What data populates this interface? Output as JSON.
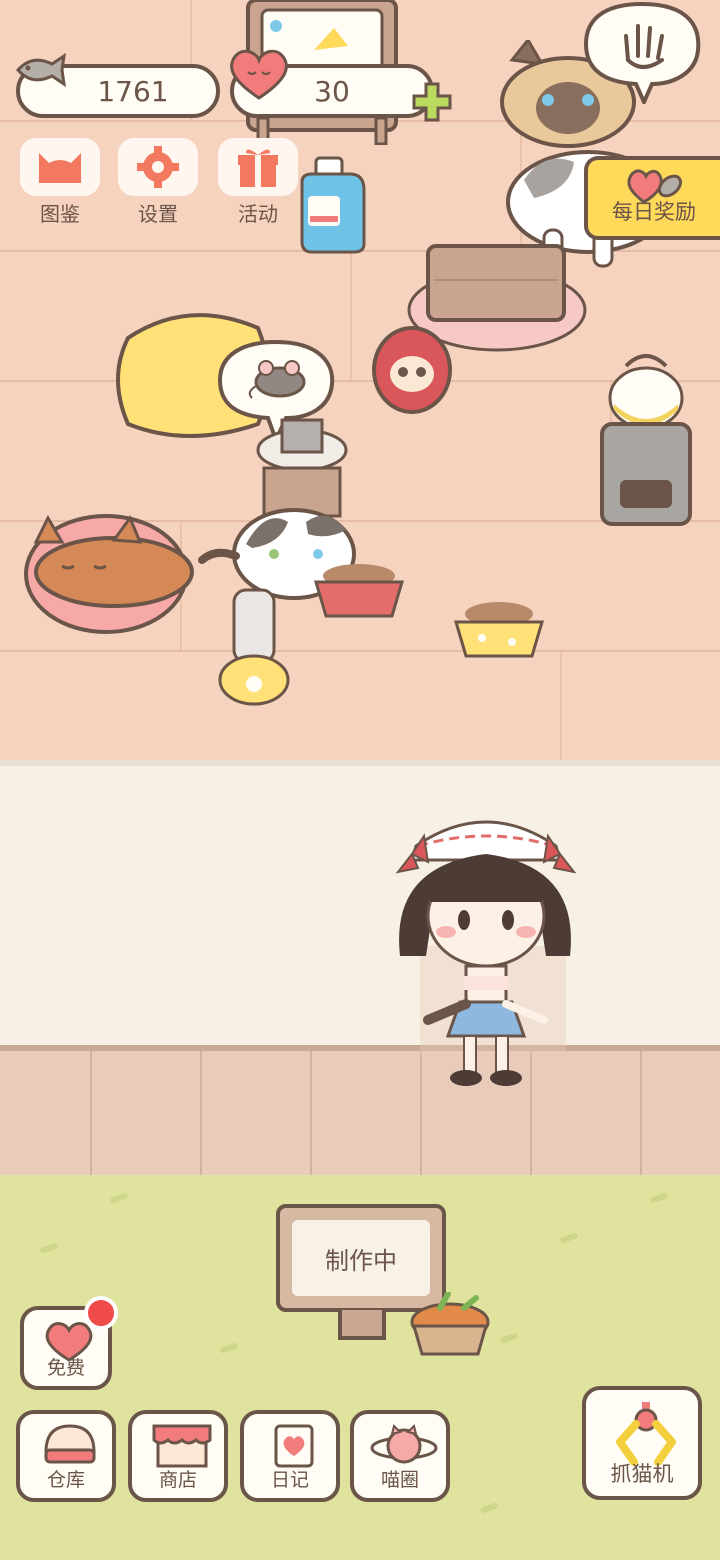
{
  "currency": {
    "fish": "1761",
    "hearts": "30"
  },
  "top_menu": {
    "collection_label": "图鉴",
    "settings_label": "设置",
    "events_label": "活动"
  },
  "daily_reward_label": "每日奖励",
  "sign_text": "制作中",
  "bottom_bar": {
    "free_label": "免费",
    "warehouse_label": "仓库",
    "shop_label": "商店",
    "diary_label": "日记",
    "meow_circle_label": "喵圈",
    "claw_machine_label": "抓猫机"
  },
  "colors": {
    "accent_pink": "#f27b7b",
    "highlight_yellow": "#ffd95a",
    "outline": "#6b5448",
    "plus_green": "#b9d95f"
  }
}
